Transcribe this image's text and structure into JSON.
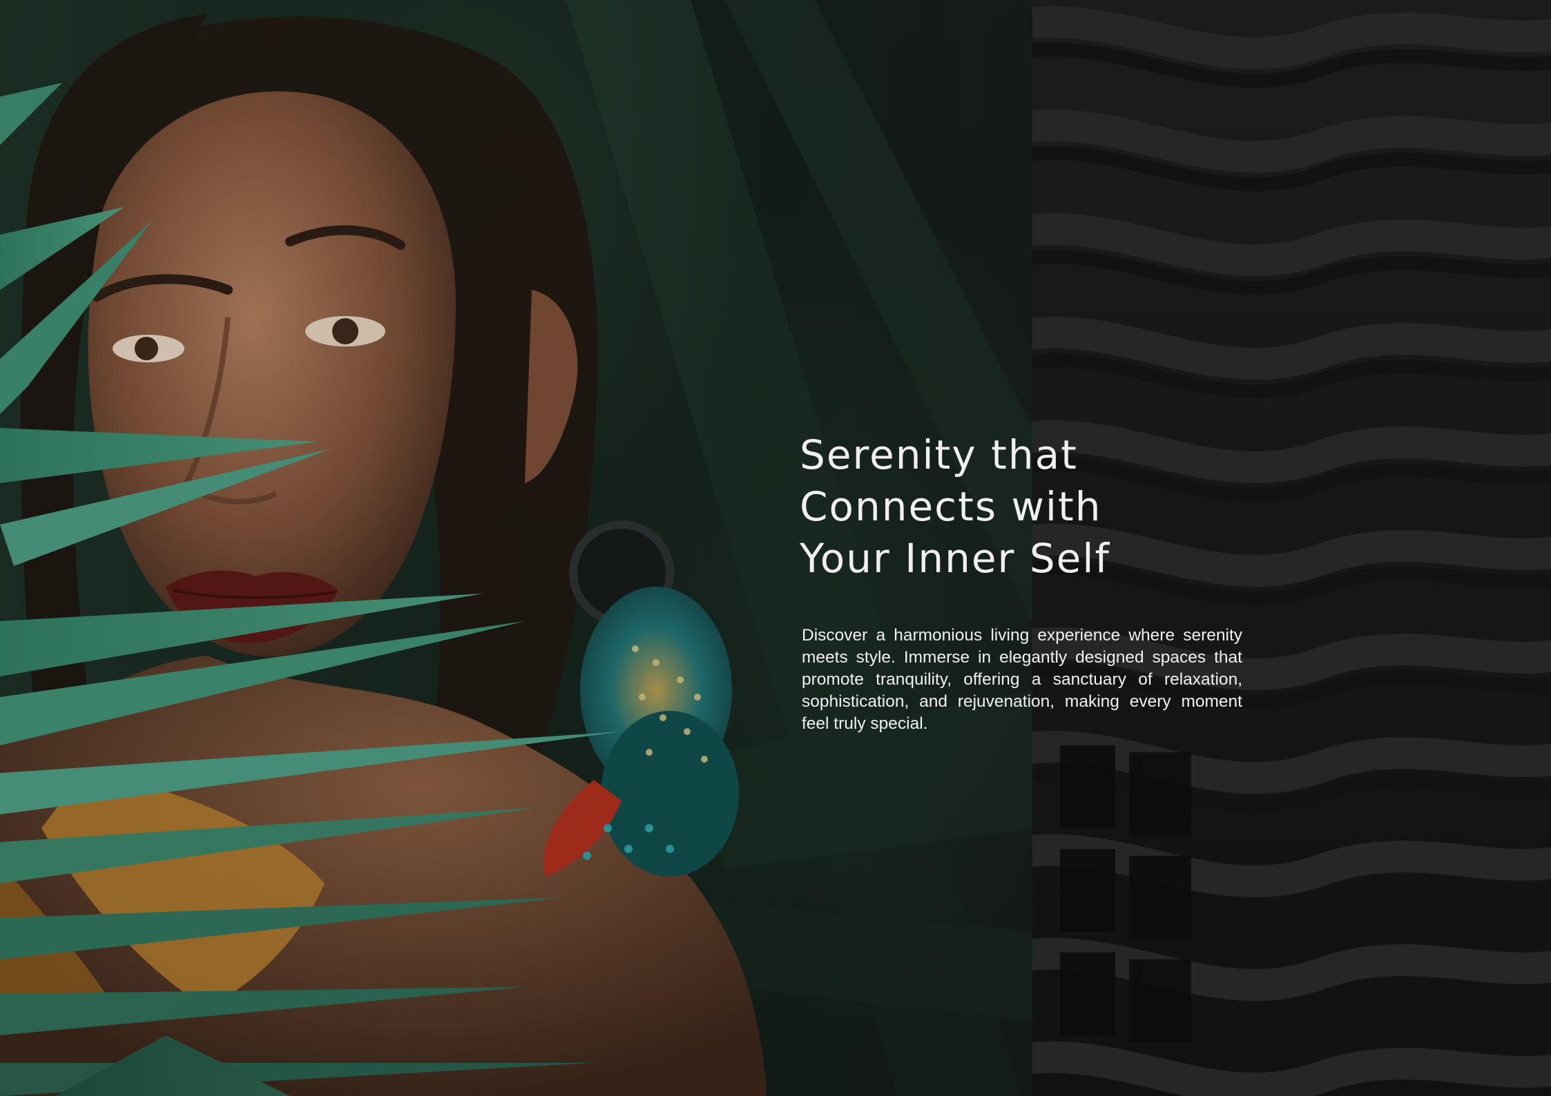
{
  "headline": {
    "line1": "Serenity that",
    "line2": "Connects with",
    "line3": "Your Inner Self"
  },
  "body": {
    "text": "Discover a harmonious living experience where serenity meets style. Immerse in elegantly designed spaces that promote tranquility, offering a sanctuary of relaxation, sophistication, and rejuvenation, making every moment feel truly special."
  },
  "colors": {
    "text": "#f2f0ec",
    "leaf_green": "#3f8a72",
    "building_grey": "#2a2a2a",
    "background_dark": "#111412"
  }
}
